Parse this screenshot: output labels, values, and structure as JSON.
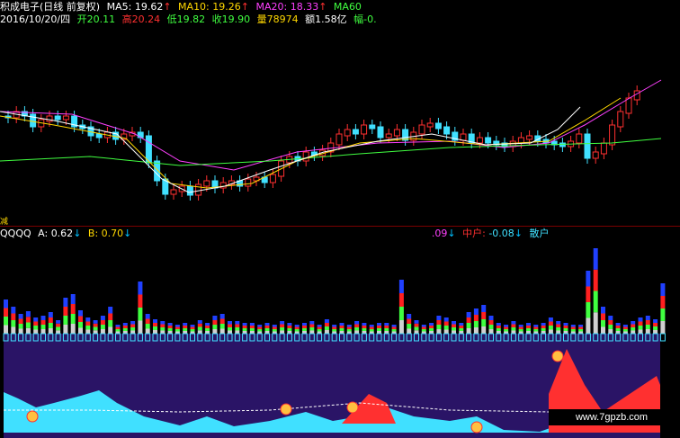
{
  "header": {
    "title": "积成电子(日线 前复权)",
    "ma5_label": "MA5:",
    "ma5_value": "19.62",
    "ma10_label": "MA10:",
    "ma10_value": "19.26",
    "ma20_label": "MA20:",
    "ma20_value": "18.33",
    "ma60_label": "MA60",
    "up_arrow": "↑",
    "date": "2016/10/20/四",
    "open_label": "开",
    "open_value": "20.11",
    "high_label": "高",
    "high_value": "20.24",
    "low_label": "低",
    "low_value": "19.82",
    "close_label": "收",
    "close_value": "19.90",
    "volume_label": "量",
    "volume_value": "78974",
    "amount_label": "额",
    "amount_value": "1.58亿",
    "amplitude_label": "幅",
    "amplitude_value": "-0."
  },
  "indicator": {
    "tag": "减",
    "name": "QQQQ",
    "a_label": "A:",
    "a_value": "0.62",
    "b_label": "B:",
    "b_value": "0.70",
    "hidden_value": ".09",
    "mid_label": "中户:",
    "mid_value": "-0.08",
    "retail_label": "散户",
    "down_arrow": "↓"
  },
  "colors": {
    "up": "#ff3030",
    "down": "#40e0ff",
    "ma5": "#ffffff",
    "ma10": "#ffd700",
    "ma20": "#ff40ff",
    "ma60": "#40ff40",
    "panel_bg": "#2a1466"
  },
  "watermark": "www.7gpzb.com"
}
